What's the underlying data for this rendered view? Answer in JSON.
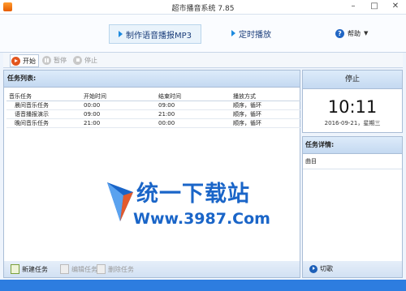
{
  "window": {
    "title": "超市播音系统 7.85",
    "controls": {
      "minimize": "–",
      "maximize": "□",
      "close": "✕"
    }
  },
  "nav": {
    "make_mp3": "制作语音播报MP3",
    "timed_play": "定时播放",
    "help": "帮助"
  },
  "toolbar": {
    "start": "开始",
    "pause": "暂停",
    "stop": "停止"
  },
  "task_list": {
    "title": "任务列表:",
    "columns": [
      "音乐任务",
      "开始时间",
      "结束时间",
      "播放方式"
    ],
    "rows": [
      {
        "name": "晨间音乐任务",
        "start": "00:00",
        "end": "09:00",
        "mode": "顺序，循环"
      },
      {
        "name": "语音播报演示",
        "start": "09:00",
        "end": "21:00",
        "mode": "顺序，循环"
      },
      {
        "name": "晚间音乐任务",
        "start": "21:00",
        "end": "00:00",
        "mode": "顺序，循环"
      }
    ]
  },
  "watermark": {
    "line1": "统一下载站",
    "line2": "Www.3987.Com"
  },
  "footer": {
    "new_task": "新建任务",
    "edit_task": "编辑任务",
    "delete_task": "删除任务"
  },
  "status": {
    "state": "停止",
    "time": "10:11",
    "date": "2016-09-21，星期三"
  },
  "detail": {
    "title": "任务详情:",
    "subtitle": "曲目"
  },
  "switch": {
    "label": "切歌"
  },
  "colors": {
    "accent": "#2d7de0",
    "start_icon": "#e2561f"
  }
}
